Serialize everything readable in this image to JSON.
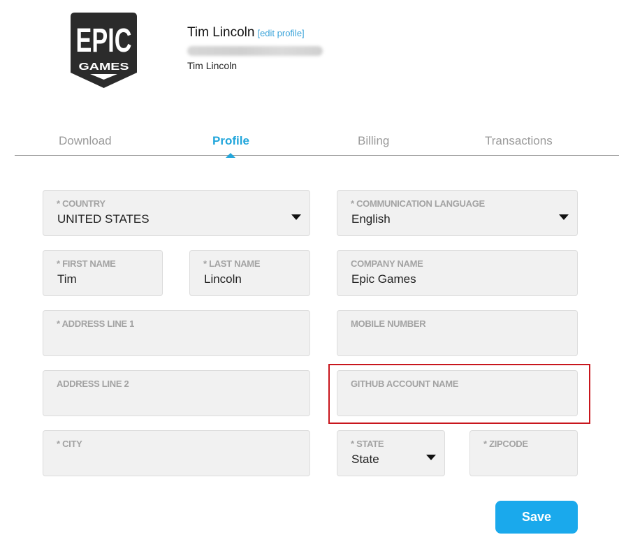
{
  "header": {
    "logo": {
      "line1": "EPIC",
      "line2": "GAMES"
    },
    "user_name": "Tim Lincoln",
    "edit_profile_label": "[edit profile]",
    "email_redacted": true,
    "display_name": "Tim Lincoln"
  },
  "tabs": [
    {
      "label": "Download",
      "active": false
    },
    {
      "label": "Profile",
      "active": true
    },
    {
      "label": "Billing",
      "active": false
    },
    {
      "label": "Transactions",
      "active": false
    }
  ],
  "form": {
    "country": {
      "label": "* COUNTRY",
      "value": "UNITED STATES"
    },
    "communication_language": {
      "label": "* COMMUNICATION LANGUAGE",
      "value": "English"
    },
    "first_name": {
      "label": "* FIRST NAME",
      "value": "Tim"
    },
    "last_name": {
      "label": "* LAST NAME",
      "value": "Lincoln"
    },
    "company_name": {
      "label": "COMPANY NAME",
      "value": "Epic Games"
    },
    "address_line_1": {
      "label": "* ADDRESS LINE 1",
      "value": ""
    },
    "mobile_number": {
      "label": "MOBILE NUMBER",
      "value": ""
    },
    "address_line_2": {
      "label": "ADDRESS LINE 2",
      "value": ""
    },
    "github_account_name": {
      "label": "GITHUB ACCOUNT NAME",
      "value": "",
      "highlighted": true
    },
    "city": {
      "label": "* CITY",
      "value": ""
    },
    "state": {
      "label": "* STATE",
      "value": "State"
    },
    "zipcode": {
      "label": "* ZIPCODE",
      "value": ""
    }
  },
  "save_label": "Save",
  "colors": {
    "accent": "#22a6db",
    "button": "#1aa9ec",
    "highlight": "#c8161d",
    "logo": "#2b2b2b"
  }
}
